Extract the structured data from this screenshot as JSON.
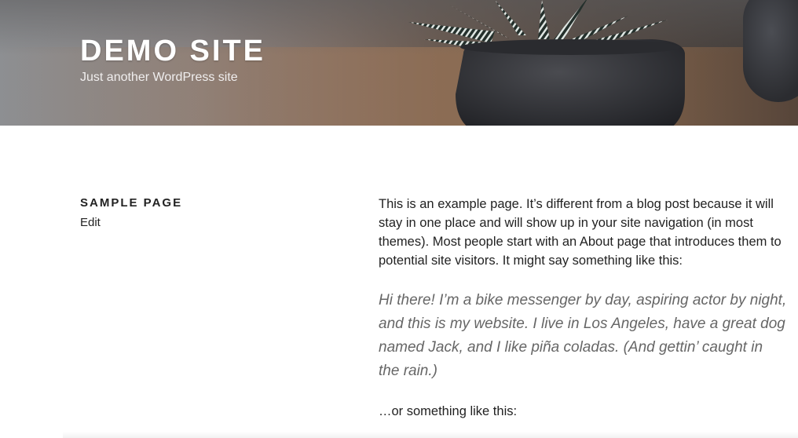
{
  "header": {
    "site_title": "DEMO SITE",
    "site_description": "Just another WordPress site",
    "header_image_icon": "potted-succulent-image"
  },
  "page": {
    "title": "SAMPLE PAGE",
    "edit_label": "Edit"
  },
  "content": {
    "intro": "This is an example page. It’s different from a blog post because it will stay in one place and will show up in your site navigation (in most themes). Most people start with an About page that introduces them to potential site visitors. It might say something like this:",
    "quote": "Hi there! I’m a bike messenger by day, aspiring actor by night, and this is my website. I live in Los Angeles, have a great dog named Jack, and I like piña coladas. (And gettin’ caught in the rain.)",
    "outro": "…or something like this:"
  },
  "colors": {
    "title_text": "#ffffff",
    "body_text": "#222222",
    "quote_text": "#666666"
  }
}
